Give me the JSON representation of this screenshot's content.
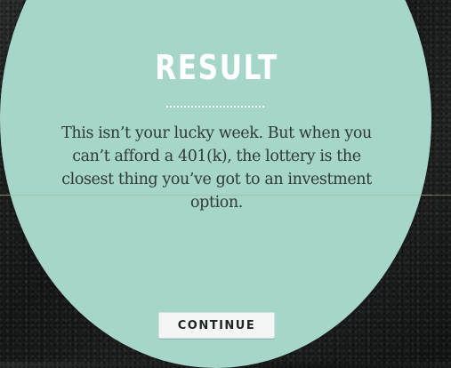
{
  "result": {
    "title": "RESULT",
    "message": "This isn’t your lucky week. But when you can’t afford a 401(k), the lottery is the closest thing you’ve got to an investment option.",
    "continue_label": "CONTINUE"
  },
  "colors": {
    "circle": "#a6d5c9",
    "title": "#ffffff",
    "text": "#2f3a37",
    "button_bg": "#f4f6f5"
  }
}
